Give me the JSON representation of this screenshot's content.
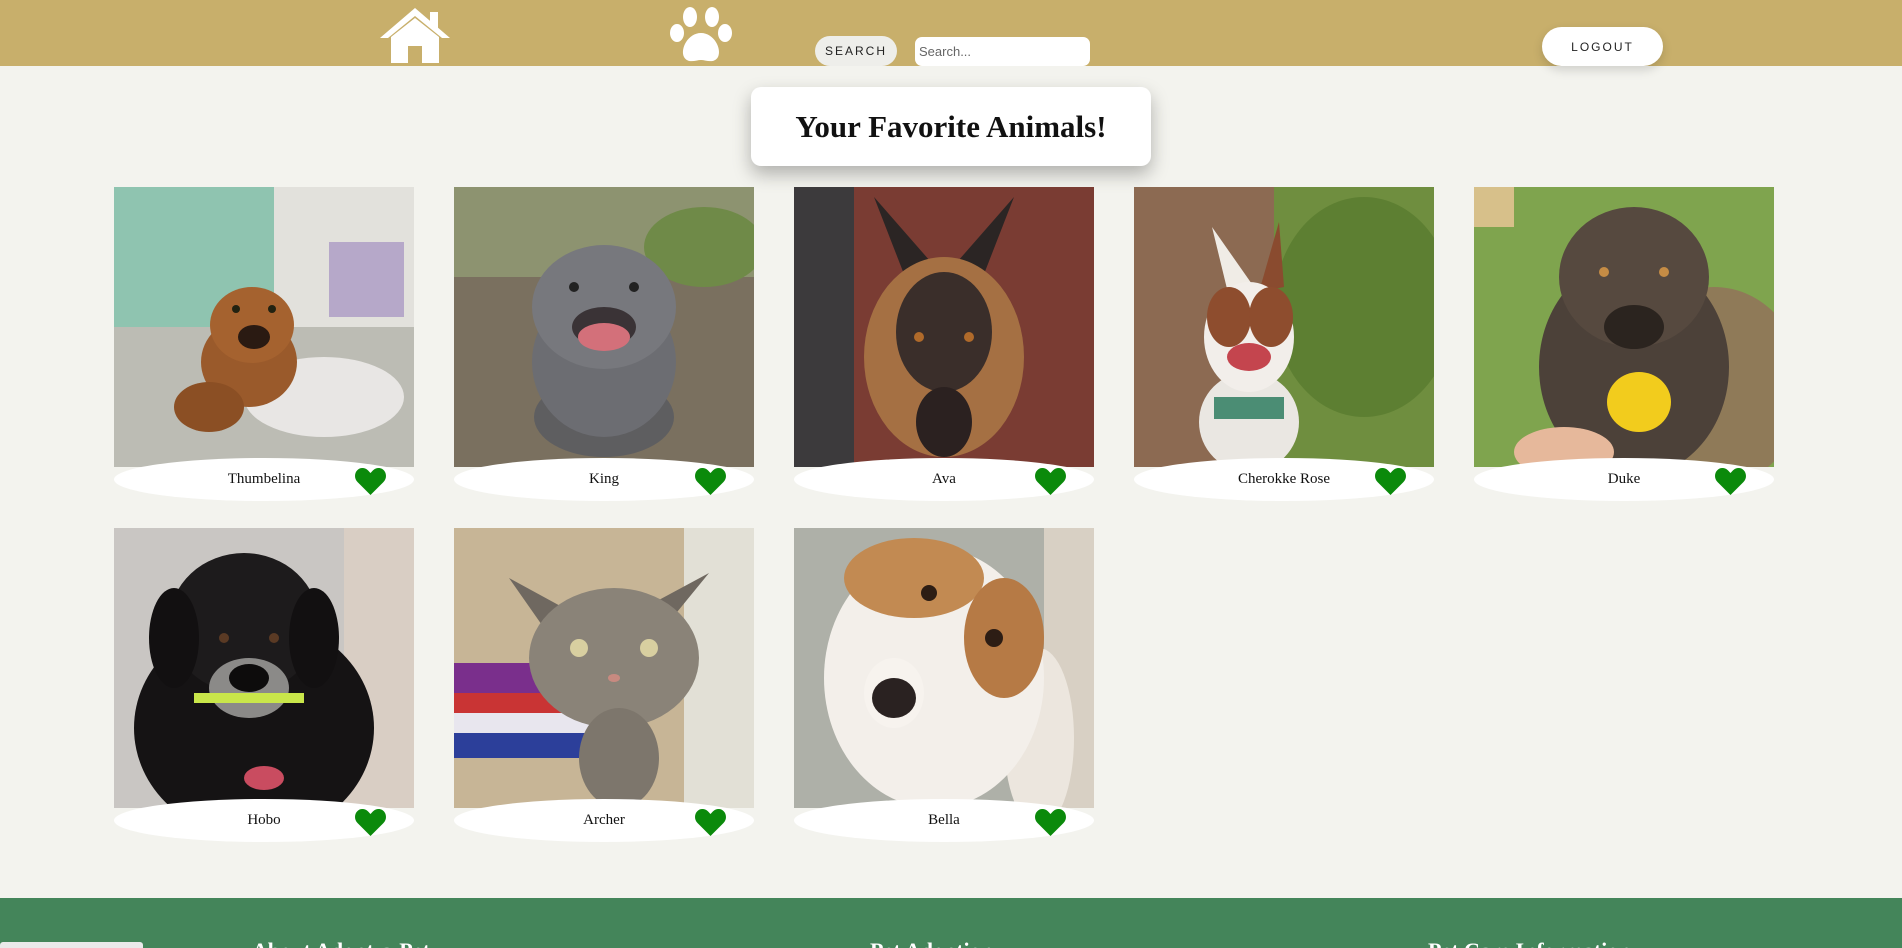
{
  "header": {
    "search_label": "SEARCH",
    "search_placeholder": "Search...",
    "logout_label": "LOGOUT",
    "home_icon": "home-icon",
    "paw_icon": "paw-icon"
  },
  "page": {
    "title": "Your Favorite Animals!"
  },
  "colors": {
    "header_bg": "#c8af6b",
    "page_bg": "#f3f3ee",
    "heart": "#0b8a0b",
    "footer_bg": "#44855a"
  },
  "animals": [
    {
      "name": "Thumbelina",
      "favorited": true
    },
    {
      "name": "King",
      "favorited": true
    },
    {
      "name": "Ava",
      "favorited": true
    },
    {
      "name": "Cherokke Rose",
      "favorited": true
    },
    {
      "name": "Duke",
      "favorited": true
    },
    {
      "name": "Hobo",
      "favorited": true
    },
    {
      "name": "Archer",
      "favorited": true
    },
    {
      "name": "Bella",
      "favorited": true
    }
  ],
  "footer": {
    "col1": "About Adopt-a-Pet",
    "col2": "Pet Adoption",
    "col3": "Pet Care Information"
  }
}
